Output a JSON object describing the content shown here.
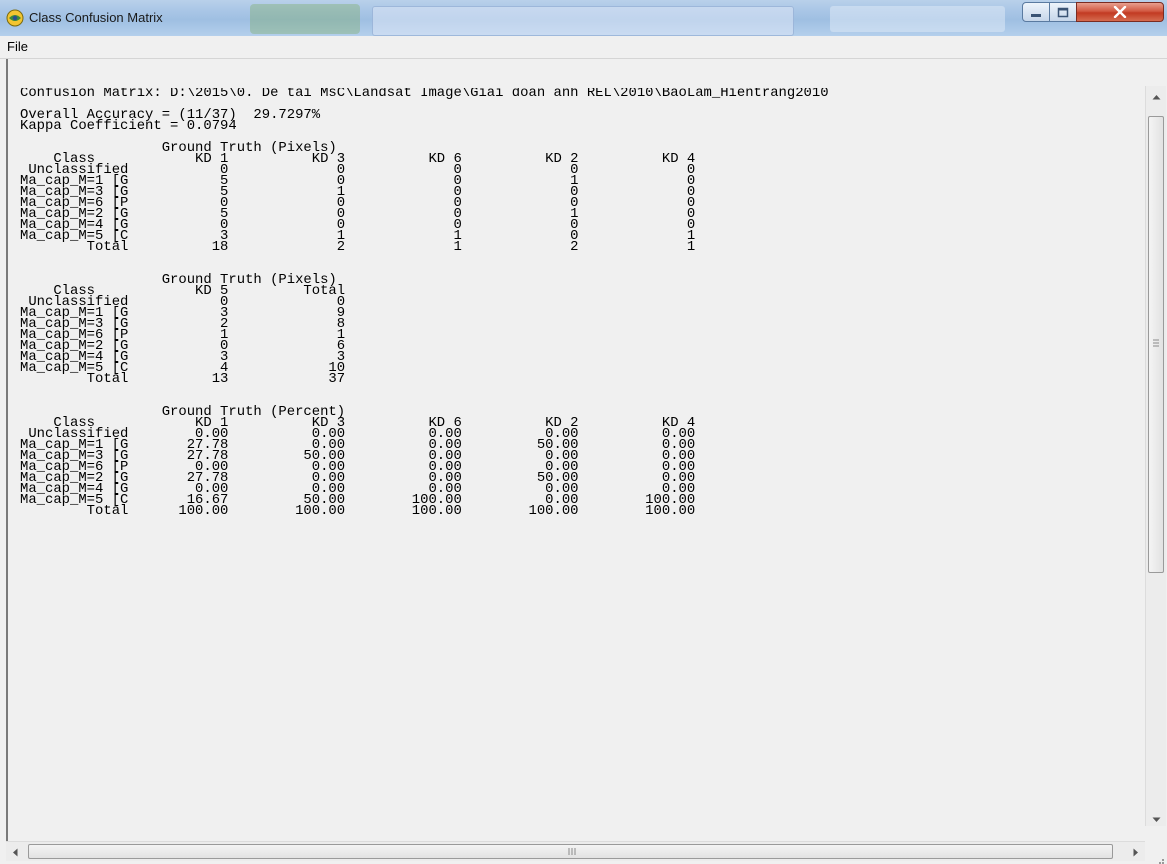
{
  "window": {
    "title": "Class Confusion Matrix",
    "icon": "envi-app-icon"
  },
  "menu": {
    "items": [
      "File"
    ]
  },
  "report": {
    "lines": [
      "Confusion Matrix: D:\\2015\\0. De tai MsC\\Landsat Image\\Giai doan anh REL\\2010\\BaoLam_Hientrang2010",
      "",
      "Overall Accuracy = (11/37)  29.7297%",
      "Kappa Coefficient = 0.0794",
      "",
      "                 Ground Truth (Pixels)",
      "    Class            KD 1          KD 3          KD 6          KD 2          KD 4",
      " Unclassified           0             0             0             0             0",
      "Ma_cap_M=1 [G           5             0             0             1             0",
      "Ma_cap_M=3 [G           5             1             0             0             0",
      "Ma_cap_M=6 [P           0             0             0             0             0",
      "Ma_cap_M=2 [G           5             0             0             1             0",
      "Ma_cap_M=4 [G           0             0             0             0             0",
      "Ma_cap_M=5 [C           3             1             1             0             1",
      "        Total          18             2             1             2             1",
      "",
      "",
      "                 Ground Truth (Pixels)",
      "    Class            KD 5         Total",
      " Unclassified           0             0",
      "Ma_cap_M=1 [G           3             9",
      "Ma_cap_M=3 [G           2             8",
      "Ma_cap_M=6 [P           1             1",
      "Ma_cap_M=2 [G           0             6",
      "Ma_cap_M=4 [G           3             3",
      "Ma_cap_M=5 [C           4            10",
      "        Total          13            37",
      "",
      "",
      "                 Ground Truth (Percent)",
      "    Class            KD 1          KD 3          KD 6          KD 2          KD 4",
      " Unclassified        0.00          0.00          0.00          0.00          0.00",
      "Ma_cap_M=1 [G       27.78          0.00          0.00         50.00          0.00",
      "Ma_cap_M=3 [G       27.78         50.00          0.00          0.00          0.00",
      "Ma_cap_M=6 [P        0.00          0.00          0.00          0.00          0.00",
      "Ma_cap_M=2 [G       27.78          0.00          0.00         50.00          0.00",
      "Ma_cap_M=4 [G        0.00          0.00          0.00          0.00          0.00",
      "Ma_cap_M=5 [C       16.67         50.00        100.00          0.00        100.00",
      "        Total      100.00        100.00        100.00        100.00        100.00"
    ]
  },
  "icons": {
    "minimize": "minimize-icon",
    "maximize": "maximize-icon",
    "close": "close-icon",
    "scroll_up": "arrow-up-icon",
    "scroll_down": "arrow-down-icon",
    "scroll_left": "arrow-left-icon",
    "scroll_right": "arrow-right-icon"
  },
  "colors": {
    "title_bar": "#a9c6e6",
    "close_button": "#c23a22",
    "background": "#f0f0f0"
  }
}
